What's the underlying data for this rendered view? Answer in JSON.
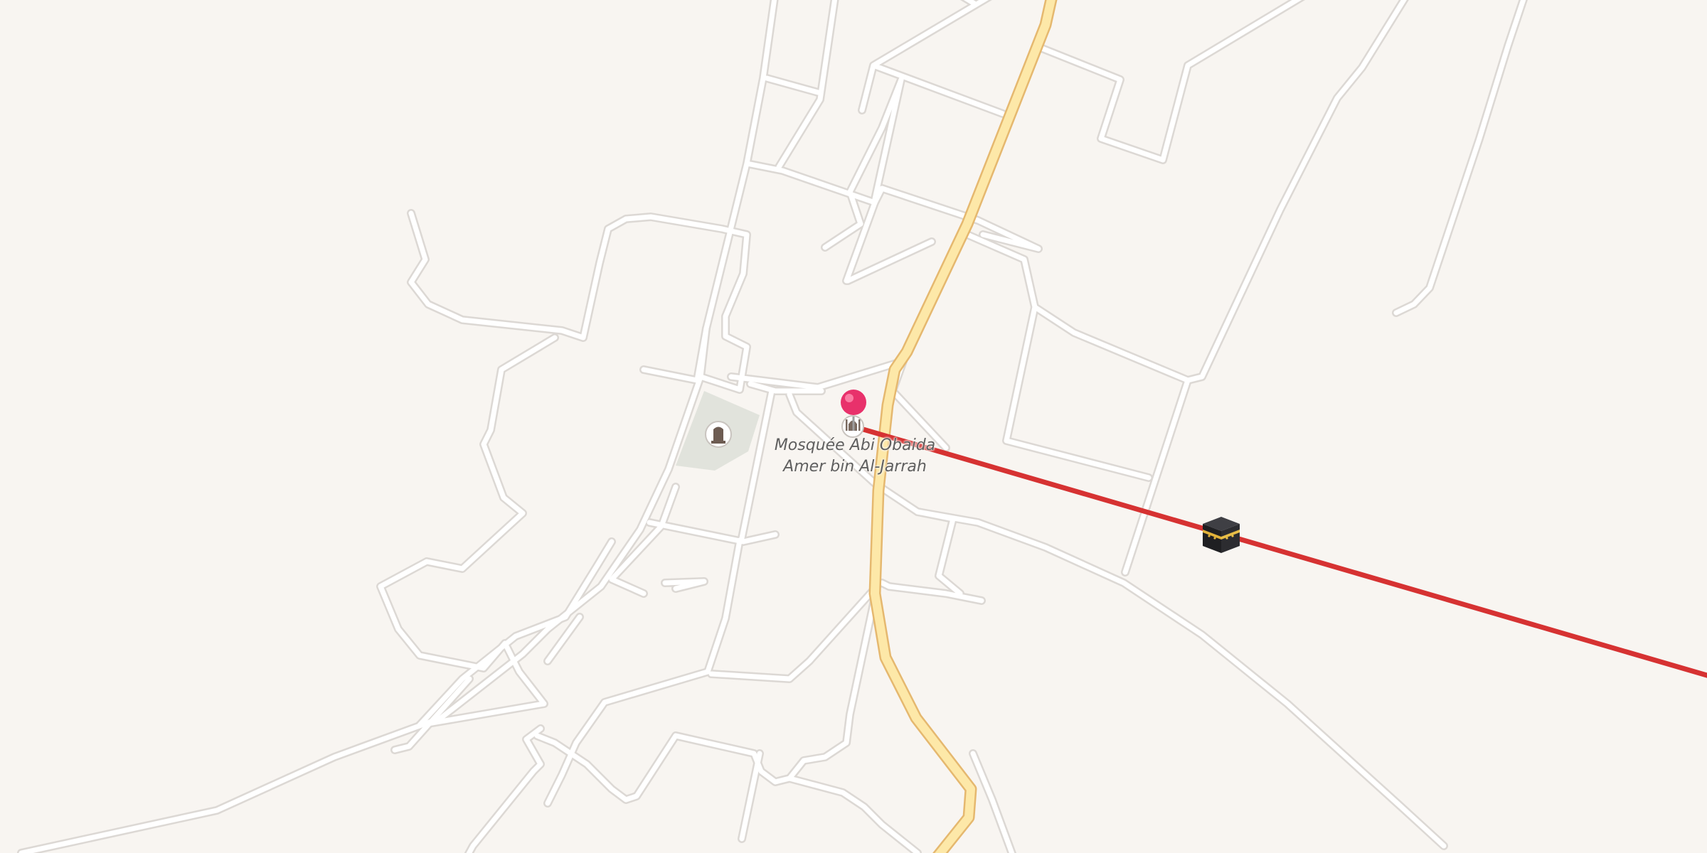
{
  "map": {
    "background": "#f8f5f1",
    "colors": {
      "minor_road_fill": "#ffffff",
      "minor_road_casing": "#dcd8d4",
      "primary_road_fill": "#fde8a8",
      "primary_road_casing": "#e5b86f",
      "park": "#e1e3dc",
      "qibla_line": "#d63232",
      "marker": "#e8316b"
    },
    "poi": {
      "label_line1": "Mosquée Abi Obaida",
      "label_line2": "Amer bin Al-Jarrah",
      "icon": "mosque-icon"
    },
    "marker": {
      "icon": "location-pin-icon"
    },
    "park_poi": {
      "icon": "cemetery-icon"
    },
    "qibla": {
      "icon": "kaaba-icon"
    }
  }
}
